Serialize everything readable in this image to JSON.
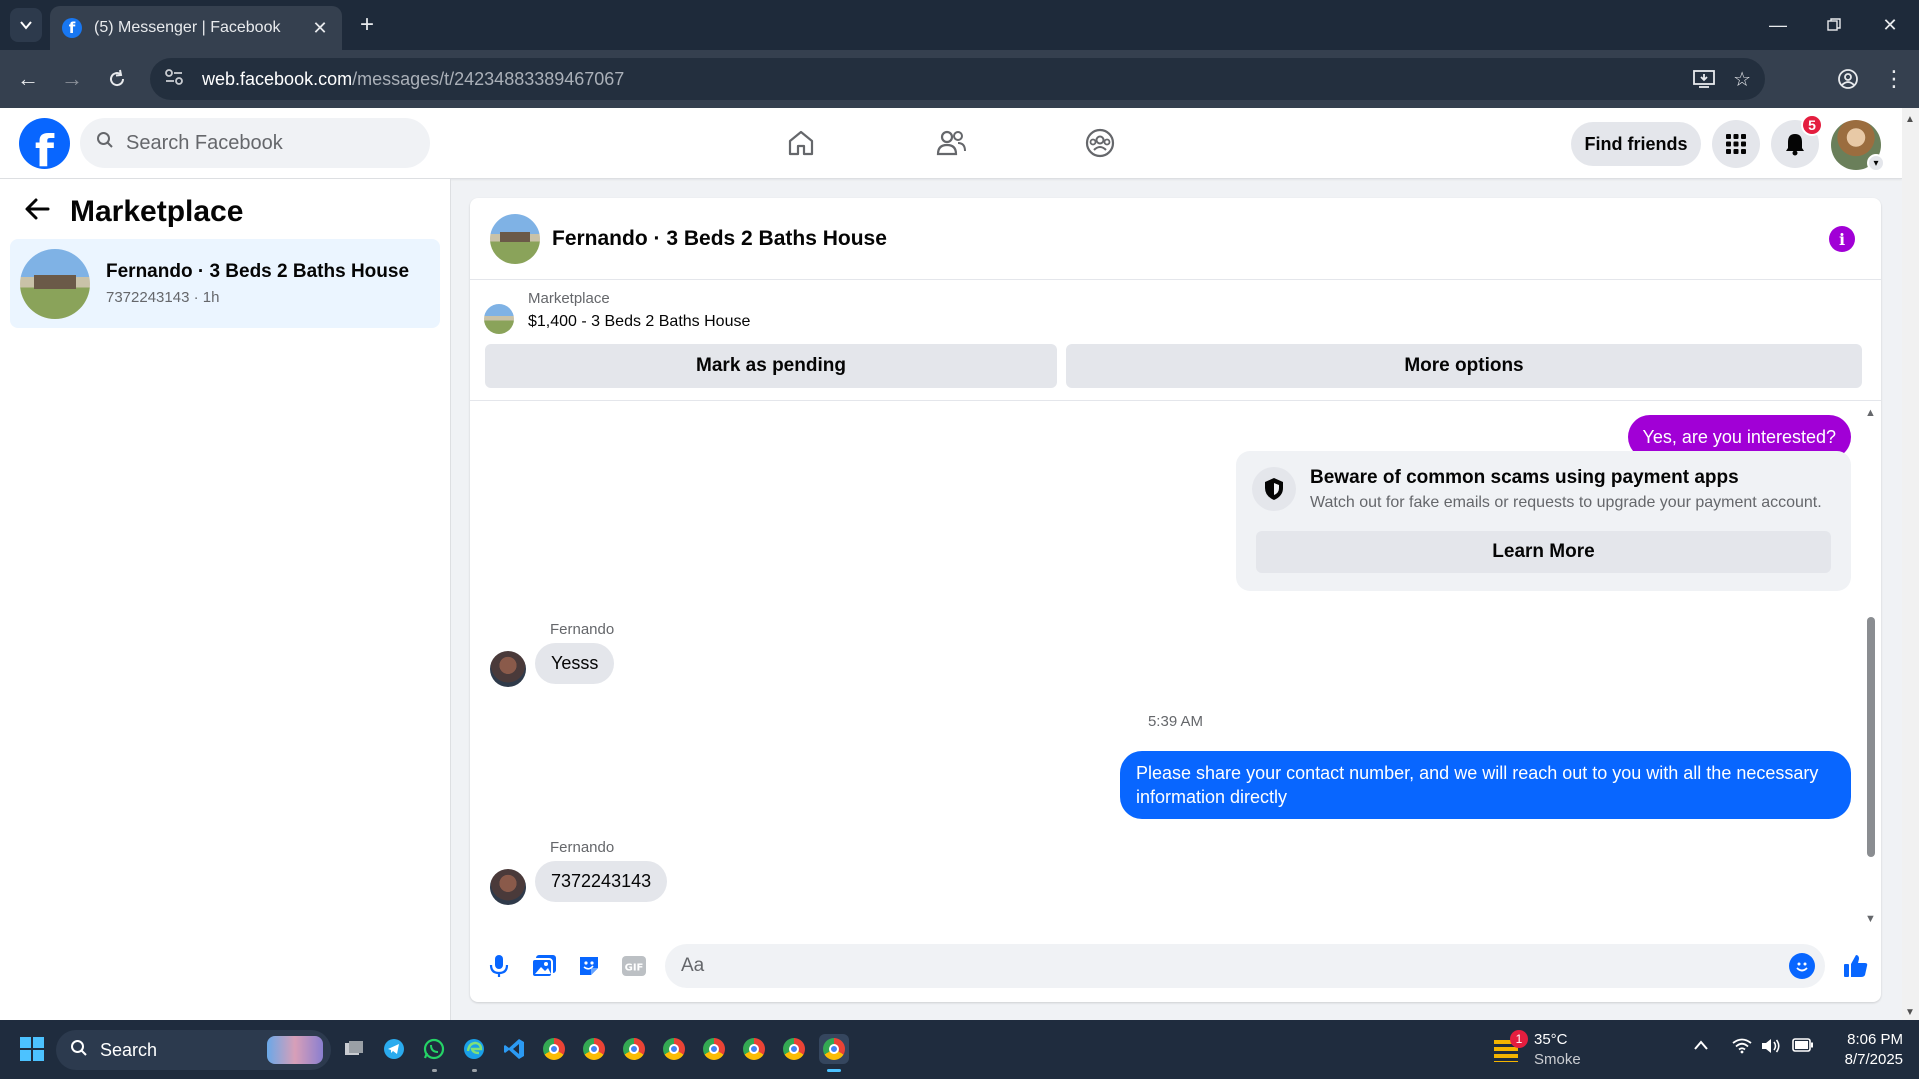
{
  "browser": {
    "tab_title": "(5) Messenger | Facebook",
    "url_host": "web.facebook.com",
    "url_path": "/messages/t/24234883389467067"
  },
  "fb_header": {
    "search_placeholder": "Search Facebook",
    "find_friends_label": "Find friends",
    "notifications_count": "5"
  },
  "left_panel": {
    "title": "Marketplace",
    "conversations": [
      {
        "name": "Fernando · 3 Beds 2 Baths House",
        "subtitle": "7372243143 · 1h"
      }
    ]
  },
  "chat": {
    "title": "Fernando · 3 Beds 2 Baths House",
    "listing_label": "Marketplace",
    "listing_price": "$1,400 - 3 Beds 2 Baths House",
    "mark_pending_label": "Mark as pending",
    "more_options_label": "More options",
    "messages": [
      {
        "text": "Yes, are you interested?"
      },
      {
        "sender": "Fernando",
        "text": "Yesss"
      },
      {
        "text": "Please share your contact number, and we will reach out to you with all the necessary information directly"
      },
      {
        "sender": "Fernando",
        "text": "7372243143"
      }
    ],
    "timestamp": "5:39 AM",
    "scam_notice": {
      "title": "Beware of common scams using payment apps",
      "description": "Watch out for fake emails or requests to upgrade your payment account.",
      "button_label": "Learn More"
    },
    "composer_placeholder": "Aa"
  },
  "taskbar": {
    "search_label": "Search",
    "weather_temp": "35°C",
    "weather_condition": "Smoke",
    "weather_badge": "1",
    "time": "8:06 PM",
    "date": "8/7/2025"
  },
  "colors": {
    "outgoing_magenta": "#a100d6",
    "outgoing_blue": "#0866ff",
    "fb_blue": "#0866ff"
  }
}
